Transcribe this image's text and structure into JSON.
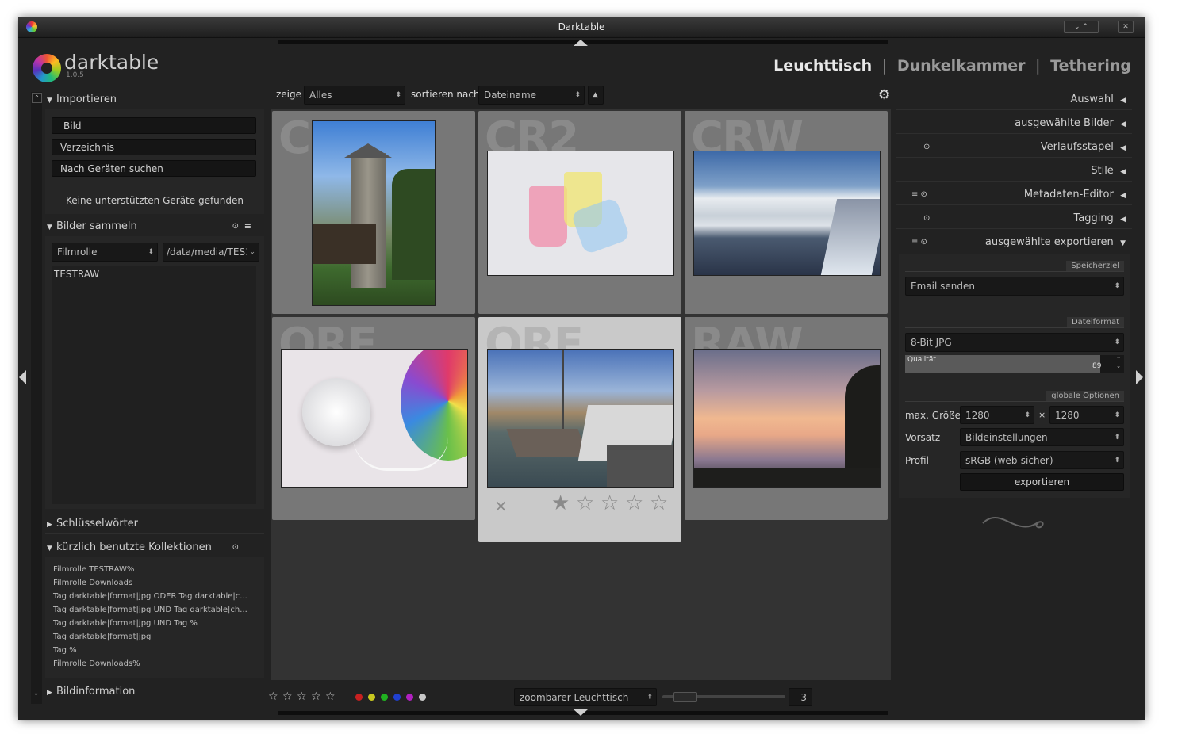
{
  "window": {
    "title": "Darktable"
  },
  "logo": {
    "name": "darktable",
    "version": "1.0.5"
  },
  "views": {
    "lighttable": "Leuchttisch",
    "darkroom": "Dunkelkammer",
    "tethering": "Tethering",
    "sep": "|"
  },
  "toolbar": {
    "show_label": "zeige",
    "show_value": "Alles",
    "sort_label": "sortieren nach",
    "sort_value": "Dateiname",
    "sort_dir": "▲"
  },
  "left": {
    "import": {
      "title": "Importieren",
      "buttons": [
        "Bild",
        "Verzeichnis",
        "Nach Geräten suchen"
      ],
      "status": "Keine unterstützten Geräte gefunden"
    },
    "collect": {
      "title": "Bilder sammeln",
      "criteria": "Filmrolle",
      "path": "/data/media/TES1",
      "items": [
        "TESTRAW"
      ]
    },
    "keywords": {
      "title": "Schlüsselwörter"
    },
    "recent": {
      "title": "kürzlich benutzte Kollektionen",
      "items": [
        "Filmrolle TESTRAW%",
        "Filmrolle Downloads",
        "Tag darktable|format|jpg ODER Tag darktable|c...",
        "Tag darktable|format|jpg UND Tag darktable|ch...",
        "Tag darktable|format|jpg UND Tag %",
        "Tag darktable|format|jpg",
        "Tag %",
        "Filmrolle Downloads%"
      ]
    },
    "info": {
      "title": "Bildinformation"
    }
  },
  "grid": {
    "thumbs": [
      {
        "ext": "C",
        "kind": "tower"
      },
      {
        "ext": "CR2",
        "kind": "cups"
      },
      {
        "ext": "CRW",
        "kind": "mountains"
      },
      {
        "ext": "ORF",
        "kind": "socket"
      },
      {
        "ext": "ORF",
        "kind": "boats",
        "selected": true,
        "reject": "×",
        "stars": [
          "★",
          "☆",
          "☆",
          "☆",
          "☆"
        ]
      },
      {
        "ext": "RAW",
        "kind": "sunset"
      }
    ]
  },
  "right": {
    "sections": [
      {
        "title": "Auswahl",
        "arrow": "◀"
      },
      {
        "title": "ausgewählte Bilder",
        "arrow": "◀"
      },
      {
        "title": "Verlaufsstapel",
        "arrow": "◀",
        "icons": "⊙"
      },
      {
        "title": "Stile",
        "arrow": "◀"
      },
      {
        "title": "Metadaten-Editor",
        "arrow": "◀",
        "icons": "≡ ⊙"
      },
      {
        "title": "Tagging",
        "arrow": "◀",
        "icons": "⊙"
      },
      {
        "title": "ausgewählte exportieren",
        "arrow": "▼",
        "icons": "≡ ⊙"
      }
    ],
    "export": {
      "target_header": "Speicherziel",
      "target": "Email senden",
      "format_header": "Dateiformat",
      "format": "8-Bit JPG",
      "quality_label": "Qualität",
      "quality_value": "89",
      "quality": 89,
      "global_header": "globale Optionen",
      "max_size_label": "max. Größe",
      "max_w": "1280",
      "times": "×",
      "max_h": "1280",
      "preset_label": "Vorsatz",
      "preset": "Bildeinstellungen",
      "profile_label": "Profil",
      "profile": "sRGB (web-sicher)",
      "export_button": "exportieren"
    }
  },
  "bottom": {
    "rating_stars": [
      "☆",
      "☆",
      "☆",
      "☆",
      "☆"
    ],
    "color_labels": [
      "#c82020",
      "#c8c820",
      "#20b020",
      "#2040d0",
      "#b020c0",
      "#c8c8c8"
    ],
    "layout": "zoombarer Leuchttisch",
    "columns": "3"
  }
}
